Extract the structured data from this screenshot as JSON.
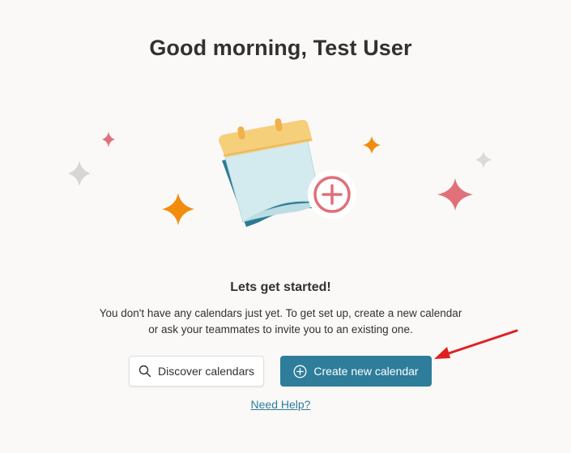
{
  "page": {
    "greeting": "Good morning, Test User",
    "heading": "Lets get started!",
    "description_line1": "You don't have any calendars just yet. To get set up, create a new calendar",
    "description_line2": "or ask your teammates to invite you to an existing one."
  },
  "actions": {
    "discover_label": "Discover calendars",
    "create_label": "Create new calendar",
    "help_label": "Need Help?"
  },
  "icons": {
    "discover": "search-icon",
    "create": "add-circle-icon",
    "illustration": "calendar-add-illustration",
    "annotation": "red-arrow-icon"
  },
  "colors": {
    "primary": "#2e7d9a",
    "background": "#faf9f8",
    "text": "#323130",
    "annotation": "#e02020",
    "sparkle_orange": "#f28c0f",
    "sparkle_pink": "#e0707a",
    "sparkle_gray": "#d8d6d4"
  }
}
